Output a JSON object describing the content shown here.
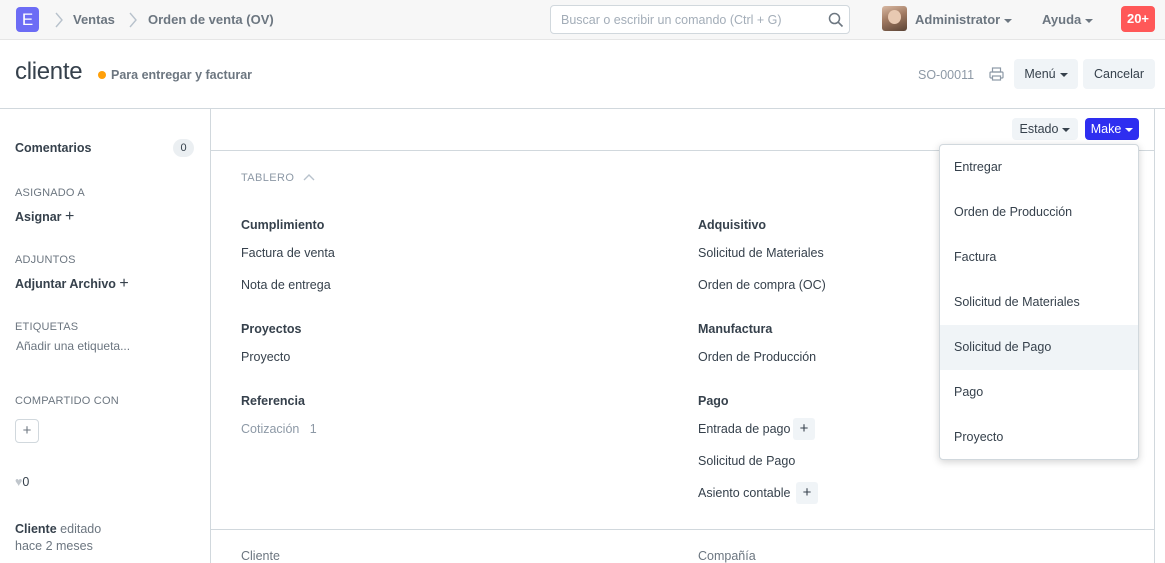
{
  "navbar": {
    "logo_letter": "E",
    "breadcrumbs": [
      "Ventas",
      "Orden de venta (OV)"
    ],
    "search_placeholder": "Buscar o escribir un comando (Ctrl + G)",
    "user_name": "Administrator",
    "help_label": "Ayuda",
    "notifications": "20+"
  },
  "page": {
    "title": "cliente",
    "status": "Para entregar y facturar",
    "status_color": "#ffa00a",
    "doc_id": "SO-00011",
    "menu_label": "Menú",
    "cancel_label": "Cancelar"
  },
  "sidebar": {
    "comments_label": "Comentarios",
    "comments_count": "0",
    "assigned_heading": "ASIGNADO A",
    "assign_label": "Asignar",
    "attachments_heading": "ADJUNTOS",
    "attach_label": "Adjuntar Archivo",
    "tags_heading": "ETIQUETAS",
    "tags_placeholder": "Añadir una etiqueta...",
    "shared_heading": "COMPARTIDO CON",
    "likes": "0",
    "activity_user": "Cliente",
    "activity_action": "editado",
    "activity_time": "hace 2 meses"
  },
  "toolbar": {
    "status_label": "Estado",
    "make_label": "Make",
    "make_color": "#2e2ef0"
  },
  "dashboard": {
    "title": "TABLERO",
    "groups": {
      "cumplimiento": {
        "title": "Cumplimiento",
        "links": [
          "Factura de venta",
          "Nota de entrega"
        ]
      },
      "adquisitivo": {
        "title": "Adquisitivo",
        "links": [
          "Solicitud de Materiales",
          "Orden de compra (OC)"
        ]
      },
      "proyectos": {
        "title": "Proyectos",
        "links": [
          "Proyecto"
        ]
      },
      "manufactura": {
        "title": "Manufactura",
        "links": [
          "Orden de Producción"
        ]
      },
      "referencia": {
        "title": "Referencia",
        "links": [
          "Cotización"
        ],
        "counts": [
          "1"
        ]
      },
      "pago": {
        "title": "Pago",
        "links": [
          "Entrada de pago",
          "Solicitud de Pago",
          "Asiento contable"
        ]
      }
    }
  },
  "fields": {
    "customer_label": "Cliente",
    "company_label": "Compañía"
  },
  "make_menu": {
    "items": [
      "Entregar",
      "Orden de Producción",
      "Factura",
      "Solicitud de Materiales",
      "Solicitud de Pago",
      "Pago",
      "Proyecto"
    ],
    "highlighted": "Solicitud de Pago"
  }
}
